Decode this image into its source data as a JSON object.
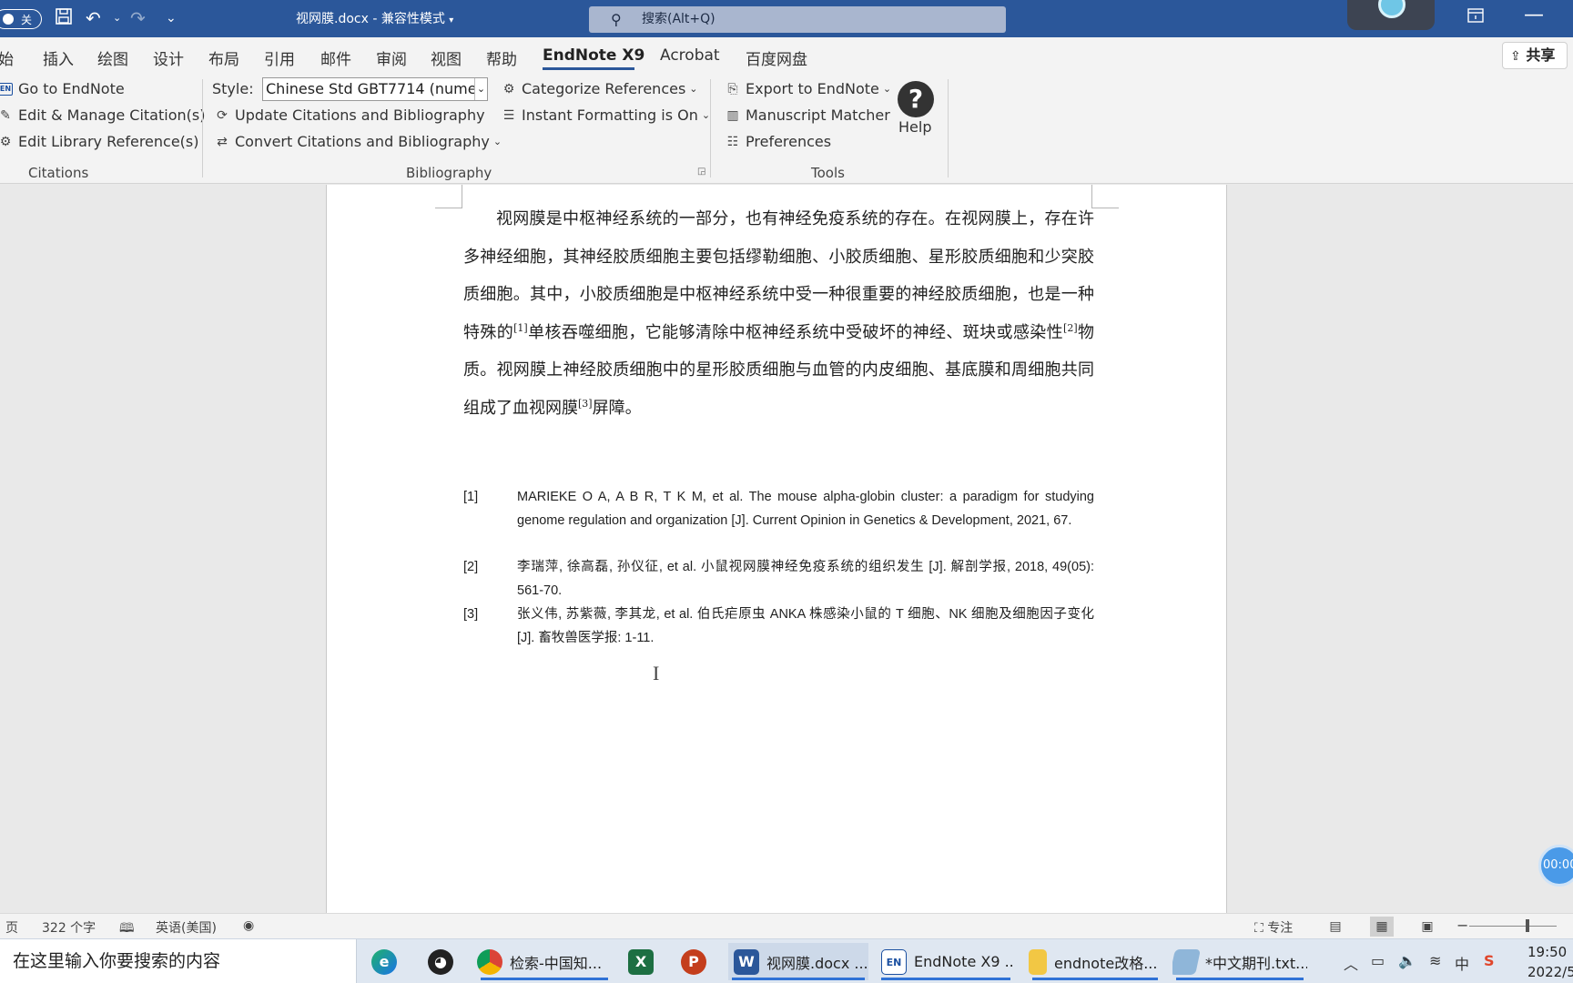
{
  "titlebar": {
    "autosave_label": "关",
    "doc_title": "视网膜.docx  -  兼容性模式",
    "search_placeholder": "搜索(Alt+Q)",
    "ribbon_display_icon": "ribbon-display-options-icon",
    "minimize_icon": "minimize-icon"
  },
  "tabs": {
    "items": [
      "始",
      "插入",
      "绘图",
      "设计",
      "布局",
      "引用",
      "邮件",
      "审阅",
      "视图",
      "帮助",
      "EndNote X9",
      "Acrobat",
      "百度网盘"
    ],
    "active": "EndNote X9",
    "share_label": "共享"
  },
  "ribbon": {
    "citations": {
      "go_to": "Go to EndNote",
      "edit_manage": "Edit & Manage Citation(s)",
      "edit_library": "Edit Library Reference(s)",
      "group": "Citations"
    },
    "bibliography": {
      "style_label": "Style:",
      "style_value": "Chinese Std GBT7714 (numer...",
      "update": "Update Citations and Bibliography",
      "convert": "Convert Citations and Bibliography",
      "categorize": "Categorize References",
      "instant_formatting": "Instant Formatting is On",
      "group": "Bibliography"
    },
    "tools": {
      "export": "Export to EndNote",
      "manuscript": "Manuscript Matcher",
      "preferences": "Preferences",
      "help": "Help",
      "group": "Tools"
    }
  },
  "document": {
    "p1": "视网膜是中枢神经系统的一部分，也有神经免疫系统的存在。在视网膜上，存在许多神经细胞，其神经胶质细胞主要包括缪勒细胞、小胶质细胞、星形胶质细胞和少突胶质细胞。其中，小胶质细胞是中枢神经系统中受一种很重要的神经胶质细胞，也是一种特殊的",
    "sup1": "[1]",
    "p2": "单核吞噬细胞，它能够清除中枢神经系统中受破坏的神经、斑块或感染性",
    "sup2": "[2]",
    "p3": "物质。视网膜上神经胶质细胞中的星形胶质细胞与血管的内皮细胞、基底膜和周细胞共同组成了血视网膜",
    "sup3": "[3]",
    "p4": "屏障。",
    "references": [
      {
        "num": "[1]",
        "text": "MARIEKE O A, A B R, T K M, et al. The mouse alpha-globin cluster: a paradigm for studying genome regulation and organization [J]. Current Opinion in Genetics & Development, 2021, 67."
      },
      {
        "num": "[2]",
        "text": "李瑞萍, 徐高磊, 孙仪征, et al. 小鼠视网膜神经免疫系统的组织发生 [J]. 解剖学报, 2018, 49(05): 561-70."
      },
      {
        "num": "[3]",
        "text": "张义伟, 苏紫薇, 李其龙, et al. 伯氏疟原虫 ANKA 株感染小鼠的 T 细胞、NK 细胞及细胞因子变化 [J]. 畜牧兽医学报: 1-11."
      }
    ]
  },
  "timer": "00:00",
  "statusbar": {
    "page": "页",
    "word_count": "322 个字",
    "language": "英语(美国)",
    "focus": "专注"
  },
  "taskbar": {
    "search_placeholder": "在这里输入你要搜索的内容",
    "apps": [
      {
        "label": "检索-中国知..."
      },
      {
        "label": "视网膜.docx ..."
      },
      {
        "label": "EndNote X9 ..."
      },
      {
        "label": "endnote改格..."
      },
      {
        "label": "*中文期刊.txt..."
      }
    ],
    "ime": "中",
    "time": "19:50",
    "date": "2022/5"
  }
}
